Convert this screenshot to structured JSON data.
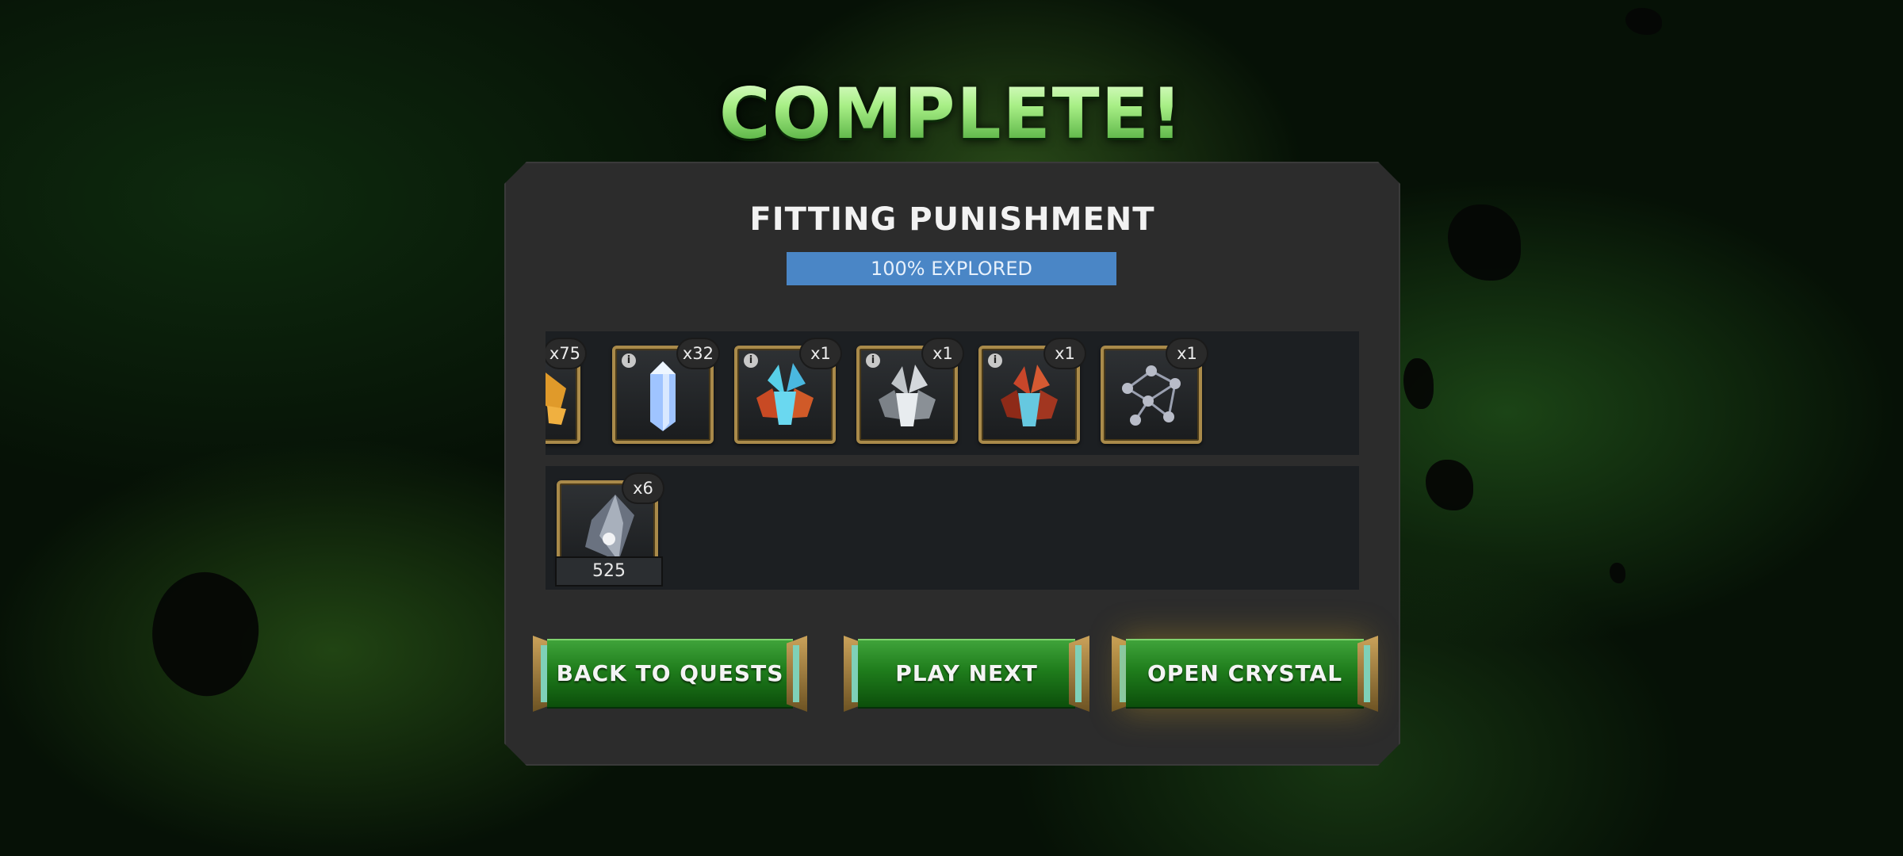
{
  "title": "COMPLETE!",
  "quest": {
    "name": "FITTING PUNISHMENT",
    "explored": "100% EXPLORED"
  },
  "rewards_row1": [
    {
      "name": "gold",
      "count": "x75",
      "info": false
    },
    {
      "name": "crystal-shard",
      "count": "x32",
      "info": true
    },
    {
      "name": "cosmic-crystal",
      "count": "x1",
      "info": true
    },
    {
      "name": "silver-crystal",
      "count": "x1",
      "info": true
    },
    {
      "name": "mutant-crystal",
      "count": "x1",
      "info": true
    },
    {
      "name": "catalyst-network",
      "count": "x1",
      "info": false
    }
  ],
  "rewards_row2": [
    {
      "name": "gem-shard",
      "count": "x6",
      "value": "525"
    }
  ],
  "buttons": {
    "back": "BACK TO QUESTS",
    "next": "PLAY NEXT",
    "open": "OPEN CRYSTAL"
  },
  "colors": {
    "title_green": "#a8ef86",
    "explored_bar": "#4a86c6",
    "button_green": "#1f7d1c",
    "frame_gold": "#a98a4a"
  }
}
